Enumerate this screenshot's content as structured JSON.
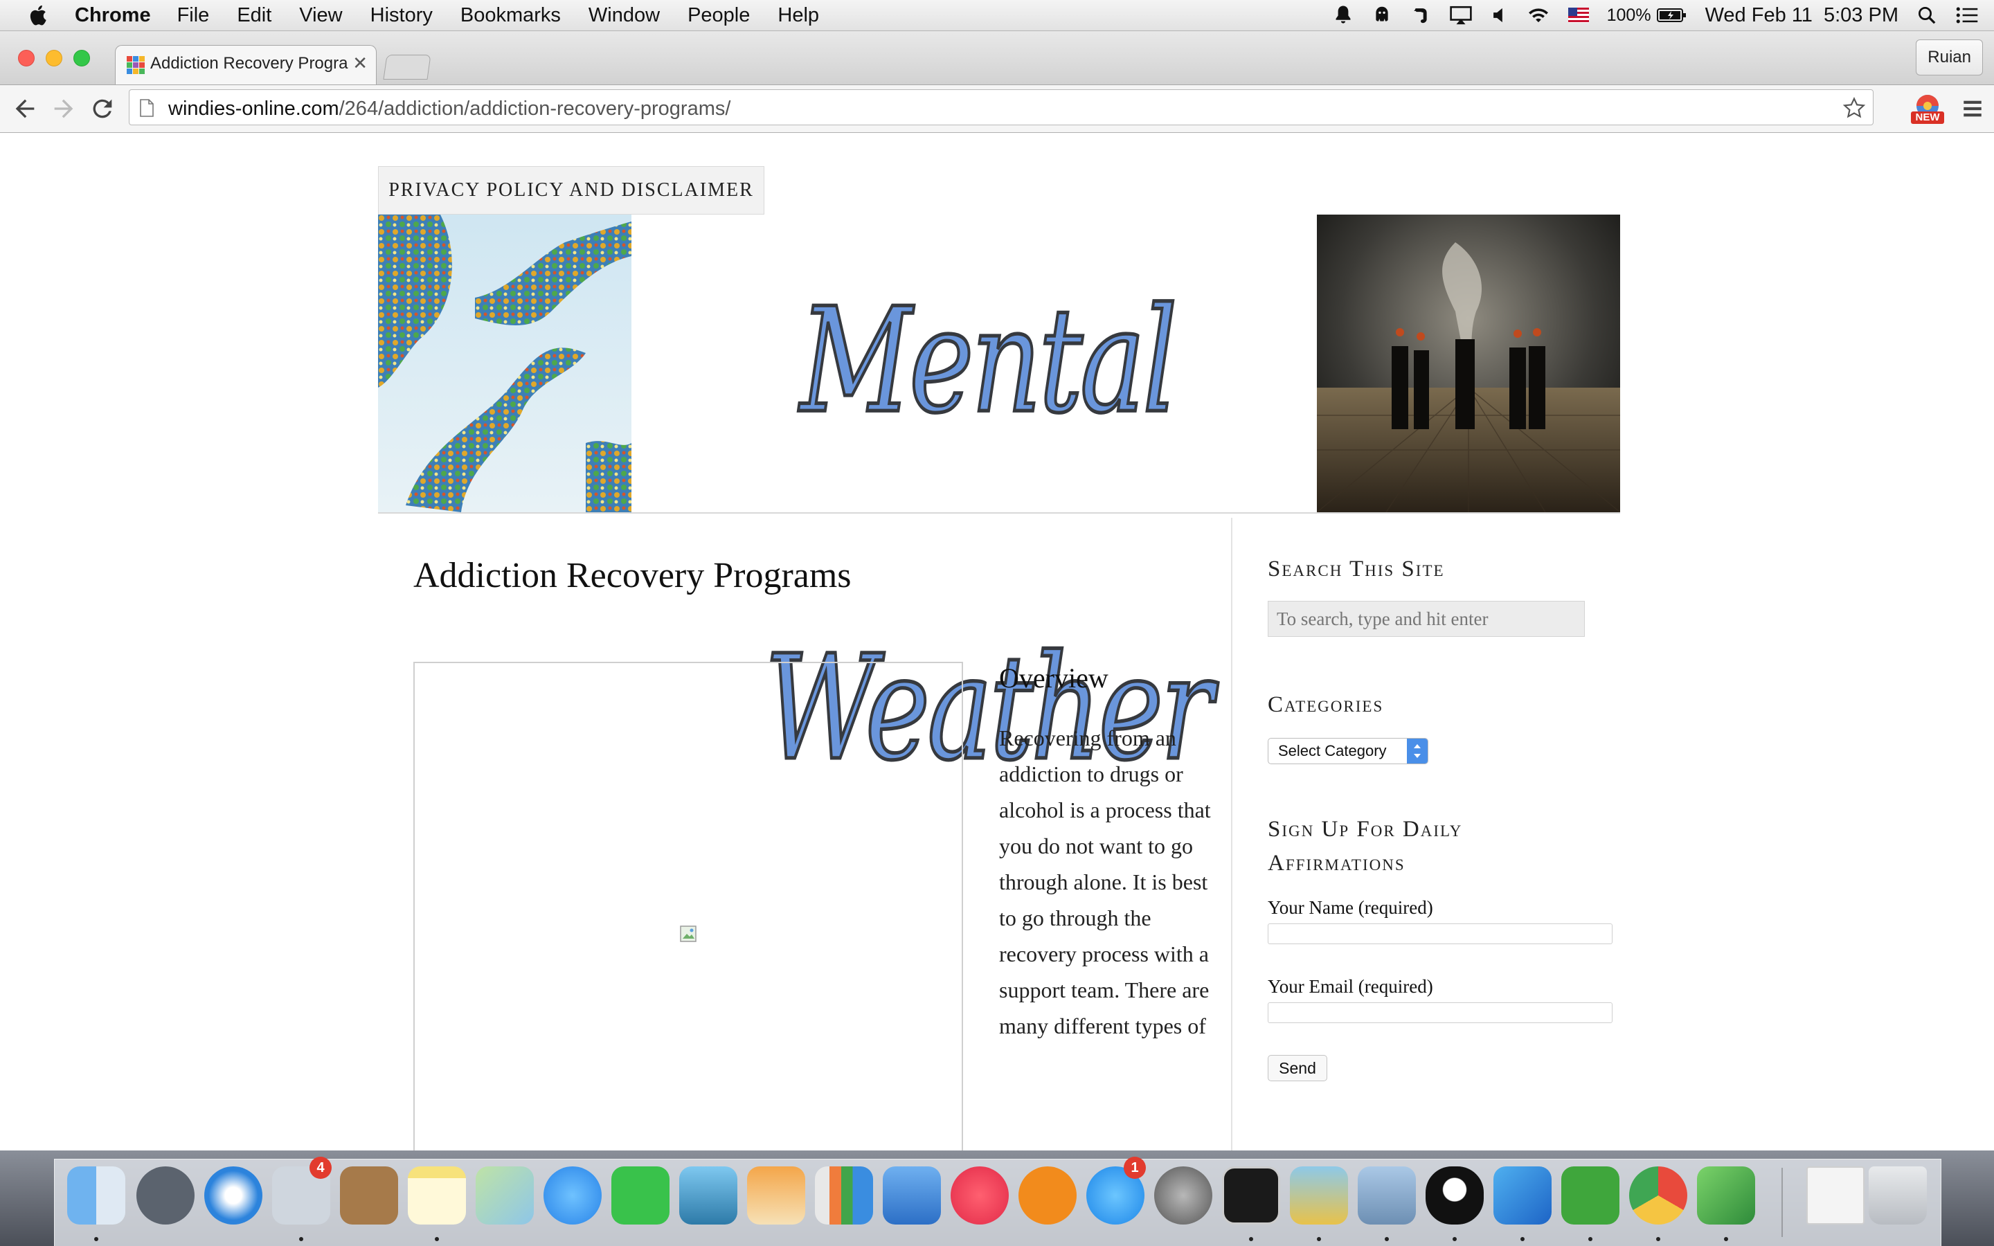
{
  "menubar": {
    "app_name": "Chrome",
    "menus": [
      "File",
      "Edit",
      "View",
      "History",
      "Bookmarks",
      "Window",
      "People",
      "Help"
    ],
    "battery": "100%",
    "clock": "Wed Feb 11  5:03 PM"
  },
  "browser": {
    "tab_title": "Addiction Recovery Progra",
    "profile_name": "Ruian",
    "url_host": "windies-online.com",
    "url_path": "/264/addiction/addiction-recovery-programs/",
    "extension_badge": "NEW"
  },
  "page": {
    "nav_privacy": "PRIVACY POLICY AND DISCLAIMER",
    "site_title": "Mental Weather",
    "post_title": "Addiction Recovery Programs",
    "section_heading": "Overview",
    "body_text": "Recovering from an addiction to drugs or alcohol is a process that you do not want to go through alone. It is best to go through the recovery process with a support team. There are many different types of"
  },
  "sidebar": {
    "search_title": "Search This Site",
    "search_placeholder": "To search, type and hit enter",
    "categories_title": "Categories",
    "categories_selected": "Select Category",
    "signup_title": "Sign Up For Daily Affirmations",
    "name_label": "Your Name (required)",
    "email_label": "Your Email (required)",
    "send_label": "Send"
  },
  "dock": {
    "items": [
      "Finder",
      "Launchpad",
      "Safari",
      "Mail",
      "Contacts",
      "Notes",
      "Maps",
      "Messages",
      "FaceTime",
      "Photos",
      "Pages",
      "Numbers",
      "Keynote",
      "iTunes",
      "iBooks",
      "App Store",
      "System Preferences",
      "Terminal",
      "Cyberduck",
      "Preview",
      "QQ",
      "Word",
      "Evernote",
      "Chrome",
      "Excel",
      "Document",
      "Trash"
    ],
    "badges": {
      "mail": "4",
      "app_store": "1"
    }
  },
  "colors": {
    "site_title_fill": "#6a96dc",
    "select_arrow": "#4a8fe8",
    "badge_red": "#e23b2e"
  }
}
